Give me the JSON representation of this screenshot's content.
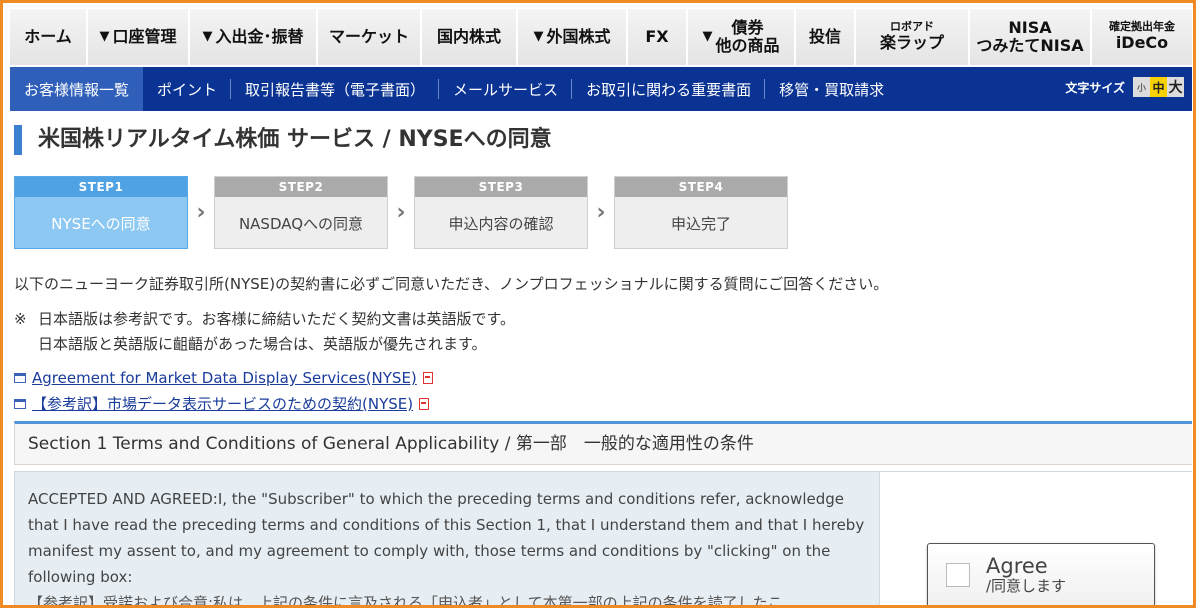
{
  "topnav": [
    {
      "label": "ホーム",
      "arrow": false
    },
    {
      "label": "口座管理",
      "arrow": true
    },
    {
      "label": "入出金･振替",
      "arrow": true
    },
    {
      "label": "マーケット",
      "arrow": false
    },
    {
      "label": "国内株式",
      "arrow": false
    },
    {
      "label": "外国株式",
      "arrow": true
    },
    {
      "label": "FX",
      "arrow": false
    }
  ],
  "topnav_other": {
    "line1": "債券",
    "line2": "他の商品"
  },
  "topnav_toushin": "投信",
  "topnav_rakuwrap": {
    "small": "ロボアド",
    "big": "楽ラップ"
  },
  "topnav_nisa": {
    "line1": "NISA",
    "line2": "つみたてNISA"
  },
  "topnav_ideco": {
    "small": "確定拠出年金",
    "big": "iDeCo"
  },
  "subnav": {
    "items": [
      "お客様情報一覧",
      "ポイント",
      "取引報告書等（電子書面）",
      "メールサービス",
      "お取引に関わる重要書面",
      "移管・買取請求"
    ],
    "fontsize_label": "文字サイズ",
    "fs_small": "小",
    "fs_medium": "中",
    "fs_large": "大"
  },
  "page_title": "米国株リアルタイム株価 サービス / NYSEへの同意",
  "steps": [
    {
      "head": "STEP1",
      "body": "NYSEへの同意"
    },
    {
      "head": "STEP2",
      "body": "NASDAQへの同意"
    },
    {
      "head": "STEP3",
      "body": "申込内容の確認"
    },
    {
      "head": "STEP4",
      "body": "申込完了"
    }
  ],
  "intro": "以下のニューヨーク証券取引所(NYSE)の契約書に必ずご同意いただき、ノンプロフェッショナルに関する質問にご回答ください。",
  "note": {
    "mark": "※",
    "line1": "日本語版は参考訳です。お客様に締結いただく契約文書は英語版です。",
    "line2": "日本語版と英語版に齟齬があった場合は、英語版が優先されます。"
  },
  "links": {
    "agreement": "Agreement for Market Data Display Services(NYSE)",
    "reference": "【参考訳】市場データ表示サービスのための契約(NYSE)"
  },
  "section": {
    "title": "Section 1 Terms and Conditions of General Applicability / 第一部　一般的な適用性の条件",
    "body_en": "ACCEPTED AND AGREED:I, the \"Subscriber\" to which the preceding terms and conditions refer, acknowledge that I have read the preceding terms and conditions of this Section 1, that I understand them and that I hereby manifest my assent to, and my agreement to comply with, those terms and conditions by \"clicking\" on the following box:",
    "body_ja": "【参考訳】受諾および合意:私は、上記の条件に言及される「申込者」として本第一部の上記の条件を読了したこ"
  },
  "agree": {
    "en": "Agree",
    "jp": "/同意します"
  }
}
